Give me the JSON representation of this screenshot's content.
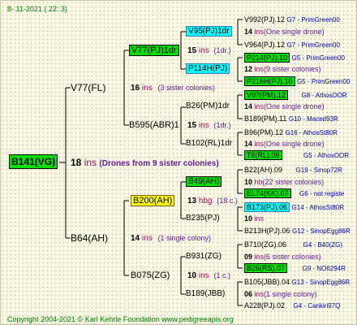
{
  "date": "8- 11-2021 ( 22: 3)",
  "root": {
    "label": "B141(VG)",
    "count": "18",
    "ins": "ins",
    "note": "(Drones from 9 sister colonies)"
  },
  "gen1": [
    {
      "label": "V77(FL)",
      "count": "16",
      "ins": "ins",
      "note": "(3 sister colonies)"
    },
    {
      "label": "B64(AH)",
      "count": "14",
      "ins": "ins",
      "note": "(1 single colony)"
    }
  ],
  "gen2": [
    {
      "label": "V77(PJ)1dr",
      "count": "15",
      "ins": "ins",
      "note": "(1dr.)"
    },
    {
      "label": "B595(ABR)1",
      "count": "15",
      "ins": "ins",
      "note": "(1dr.)"
    },
    {
      "label": "B200(AH)",
      "count": "13",
      "ins": "hbg",
      "note": "(18 c.)"
    },
    {
      "label": "B075(ZG)",
      "count": "10",
      "ins": "ins",
      "note": "(1 c.)"
    }
  ],
  "gen3": [
    {
      "label": "V95(PJ)1dr",
      "count": "14",
      "ins": "ins",
      "note": "(One single drone)"
    },
    {
      "label": "P114H(PJ)",
      "count": "12",
      "ins": "ins",
      "note": "(9 sister colonies)"
    },
    {
      "label": "B26(PM)1dr",
      "count": "14",
      "ins": "ins",
      "note": "(One single drone)"
    },
    {
      "label": "B102(RL)1dr",
      "count": "14",
      "ins": "ins",
      "note": "(One single drone)"
    },
    {
      "label": "B49(AH)",
      "count": "10",
      "ins": "hb",
      "note": "(22 sister colonies)"
    },
    {
      "label": "B235(PJ)",
      "count": "10",
      "ins": "ins",
      "note": ""
    },
    {
      "label": "B931(ZG)",
      "count": "09",
      "ins": "ins",
      "note": "(6 sister colonies)"
    },
    {
      "label": "B189(JBB)",
      "count": "06",
      "ins": "ins",
      "note": "(1 single colony)"
    }
  ],
  "gen4": [
    {
      "label": "V992(PJ).12",
      "info": "G7 - PrimGreen00"
    },
    {
      "label": "V964(PJ).12",
      "info": "G7 - PrimGreen00"
    },
    {
      "label": "P214(PJ).10",
      "info": "G5 - PrimGreen00"
    },
    {
      "label": "P216H(PJ).10",
      "info": "G5 - PrimGreen00"
    },
    {
      "label": "V97(PM).12",
      "info": "G8 - AthosOOR"
    },
    {
      "label": "B189(PM).11",
      "info": "G10 - Maced93R"
    },
    {
      "label": "B96(PM).12",
      "info": "G16 - AthosSt80R"
    },
    {
      "label": "T8(RL).09",
      "info": "G5 - AthosOOR"
    },
    {
      "label": "B22(AH).09",
      "info": "G19 - Sinop72R"
    },
    {
      "label": "EL74(KK).07",
      "info": "G6 - not registe"
    },
    {
      "label": "B173(PJ).06",
      "info": "G14 - AthosSt80R"
    },
    {
      "label": "B213H(PJ).06",
      "info": "G12 - SinopEgg86R"
    },
    {
      "label": "B710(ZG).06",
      "info": "G4 - B40(ZG)"
    },
    {
      "label": "B26(RS).07",
      "info": "G9 - NO6294R"
    },
    {
      "label": "B105(JBB).04",
      "info": "G13 - SinopEgg86R"
    },
    {
      "label": "A228(PJ).02",
      "info": "G4 - Cankiri97Q"
    }
  ],
  "footer": "Copyright 2004-2021 © Karl Kehrle Foundation    www.pedigreeapis.org",
  "colors": {
    "green_box": "#00e000",
    "cyan_box": "#00ffff",
    "yellow_box": "#ffff00",
    "ins": "#c0006c",
    "note": "#6a1aa0",
    "info": "#0000b0"
  }
}
